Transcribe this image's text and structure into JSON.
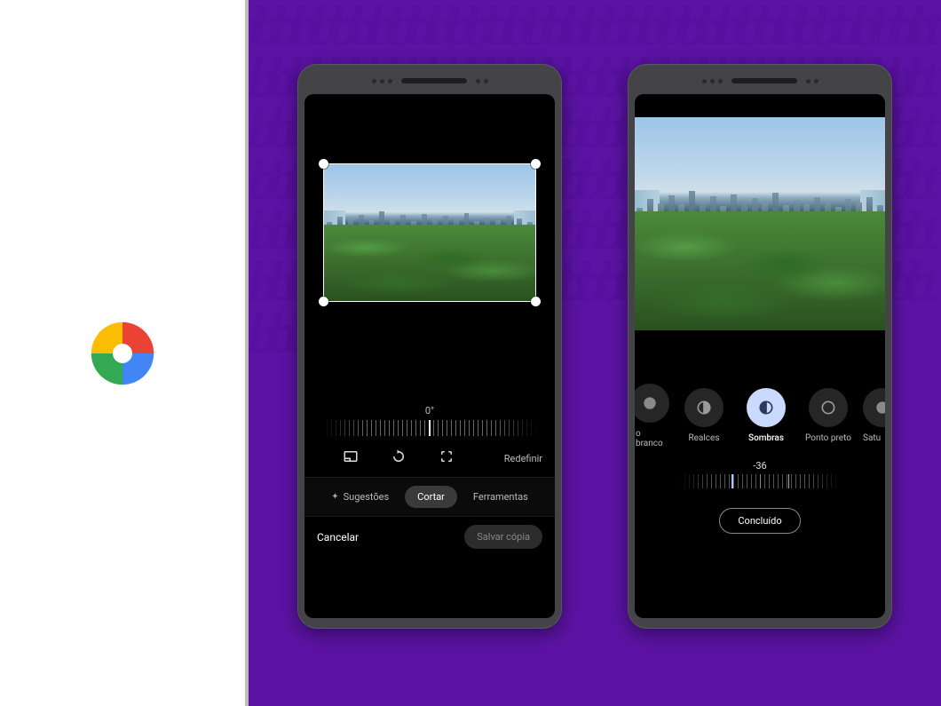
{
  "screen1": {
    "rotation_value": "0°",
    "reset_label": "Redefinir",
    "tab_suggestions": "Sugestões",
    "tab_crop": "Cortar",
    "tab_tools": "Ferramentas",
    "cancel_label": "Cancelar",
    "save_copy_label": "Salvar cópia"
  },
  "screen2": {
    "adjust_items": {
      "whitepoint_partial": "o branco",
      "highlights": "Realces",
      "shadows": "Sombras",
      "blackpoint": "Ponto preto",
      "saturation_partial": "Satu"
    },
    "selected_adjust": "shadows",
    "value": "-36",
    "done_label": "Concluído"
  }
}
